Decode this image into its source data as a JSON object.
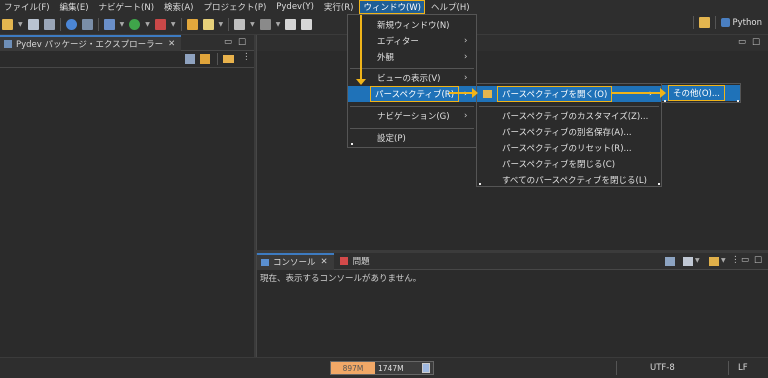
{
  "menubar": {
    "items": [
      "ファイル(F)",
      "編集(E)",
      "ナビゲート(N)",
      "検索(A)",
      "プロジェクト(P)",
      "Pydev(Y)",
      "実行(R)"
    ],
    "active": "ウィンドウ(W)",
    "help": "ヘルプ(H)"
  },
  "toolbar": {
    "perspective_label": "Python"
  },
  "explorer": {
    "tab_label": "Pydev パッケージ・エクスプローラー",
    "close": "✕"
  },
  "console": {
    "tab_label": "コンソール",
    "problems_label": "問題",
    "message": "現在、表示するコンソールがありません。"
  },
  "window_menu": {
    "items": [
      "新規ウィンドウ(N)",
      "エディター",
      "外観",
      "ビューの表示(V)",
      "パースペクティブ(R)",
      "ナビゲーション(G)",
      "設定(P)"
    ]
  },
  "perspective_menu": {
    "items": [
      "パースペクティブを開く(O)",
      "パースペクティブのカスタマイズ(Z)...",
      "パースペクティブの別名保存(A)...",
      "パースペクティブのリセット(R)...",
      "パースペクティブを閉じる(C)",
      "すべてのパースペクティブを閉じる(L)"
    ]
  },
  "open_menu": {
    "other": "その他(O)..."
  },
  "statusbar": {
    "heap_used": "897M",
    "heap_total": "1747M",
    "heap_used_fraction": 0.51,
    "encoding": "UTF-8",
    "line_ending": "LF"
  },
  "colors": {
    "accent_highlight": "#1f72b8",
    "annotation": "#f0b419",
    "heap_bar": "#f1a867"
  },
  "icons": {
    "submenu_arrow": "›",
    "maximize": "□",
    "minimize": "▭",
    "view_menu": "⋮"
  }
}
